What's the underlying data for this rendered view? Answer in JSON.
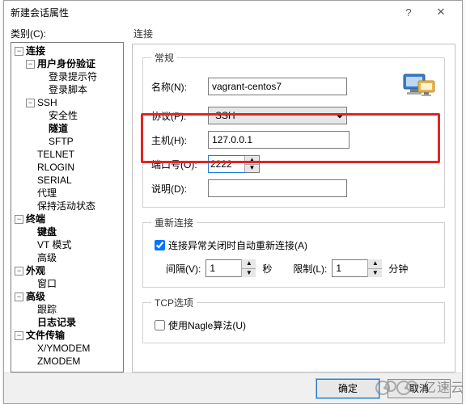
{
  "window": {
    "title": "新建会话属性",
    "help_icon": "?",
    "close_icon": "✕"
  },
  "category_label": "类别(C):",
  "tree": {
    "connection": "连接",
    "user_auth": "用户身份验证",
    "login_prompt": "登录提示符",
    "login_script": "登录脚本",
    "ssh": "SSH",
    "security": "安全性",
    "tunnel": "隧道",
    "sftp": "SFTP",
    "telnet": "TELNET",
    "rlogin": "RLOGIN",
    "serial": "SERIAL",
    "proxy": "代理",
    "keep_alive": "保持活动状态",
    "terminal": "终端",
    "keyboard": "键盘",
    "vt_mode": "VT 模式",
    "advanced_term": "高级",
    "appearance": "外观",
    "window": "窗口",
    "advanced": "高级",
    "tracking": "跟踪",
    "logging": "日志记录",
    "file_transfer": "文件传输",
    "xymodem": "X/YMODEM",
    "zmodem": "ZMODEM"
  },
  "right_title": "连接",
  "general": {
    "legend": "常规",
    "name_label": "名称(N):",
    "name_value": "vagrant-centos7",
    "protocol_label": "协议(P):",
    "protocol_value": "SSH",
    "host_label": "主机(H):",
    "host_value": "127.0.0.1",
    "port_label": "端口号(O):",
    "port_value": "2222",
    "desc_label": "说明(D):",
    "desc_value": ""
  },
  "reconnect": {
    "legend": "重新连接",
    "auto_label": "连接异常关闭时自动重新连接(A)",
    "auto_checked": true,
    "interval_label": "间隔(V):",
    "interval_value": "1",
    "seconds": "秒",
    "limit_label": "限制(L):",
    "limit_value": "1",
    "minutes": "分钟"
  },
  "tcp": {
    "legend": "TCP选项",
    "nagle_label": "使用Nagle算法(U)",
    "nagle_checked": false
  },
  "footer": {
    "ok": "确定",
    "cancel": "取消"
  },
  "watermark": "亿速云"
}
